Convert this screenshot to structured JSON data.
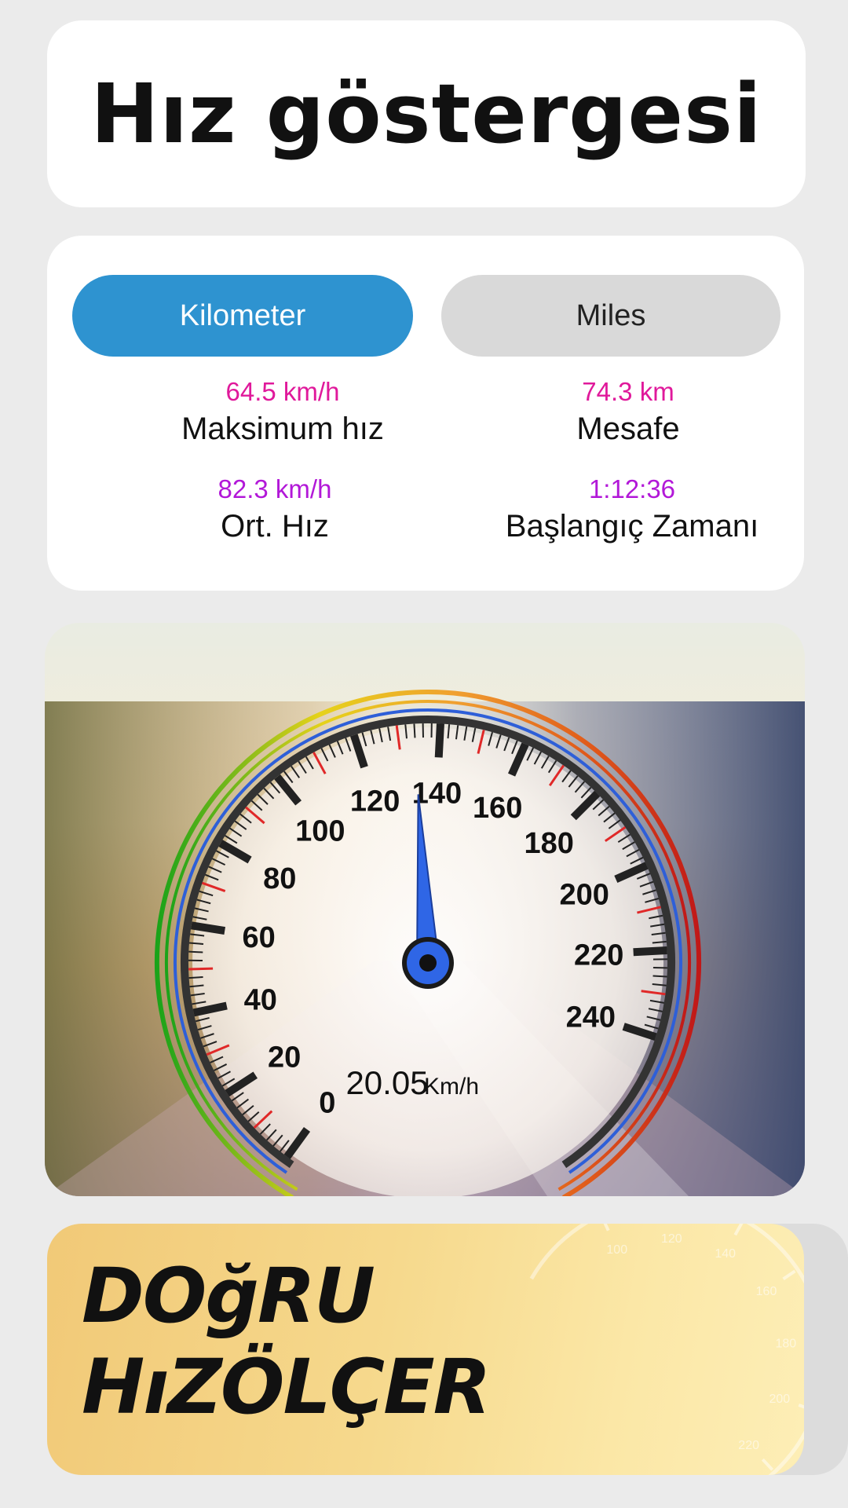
{
  "title": "Hız göstergesi",
  "units": {
    "kilometer_label": "Kilometer",
    "miles_label": "Miles",
    "selected": "Kilometer"
  },
  "stats": {
    "max_speed": {
      "value": "64.5 km/h",
      "label": "Maksimum hız"
    },
    "distance": {
      "value": "74.3 km",
      "label": "Mesafe"
    },
    "avg_speed": {
      "value": "82.3 km/h",
      "label": "Ort. Hız"
    },
    "start_time": {
      "value": "1:12:36",
      "label": "Başlangıç Zamanı"
    }
  },
  "gauge": {
    "ticks": [
      "0",
      "20",
      "40",
      "60",
      "80",
      "100",
      "120",
      "140",
      "160",
      "180",
      "200",
      "220",
      "240"
    ],
    "needle_value": 134,
    "speed_value": "20.05",
    "speed_unit": "Km/h"
  },
  "banner": {
    "line1": "DOğRU",
    "line2": "HıZÖLÇER",
    "gauge_ticks": [
      "100",
      "120",
      "140",
      "160",
      "180",
      "200",
      "220"
    ]
  },
  "colors": {
    "accent": "#2e93d0",
    "pink": "#e0199b",
    "purple": "#b218d8",
    "needle": "#2f66e6"
  }
}
